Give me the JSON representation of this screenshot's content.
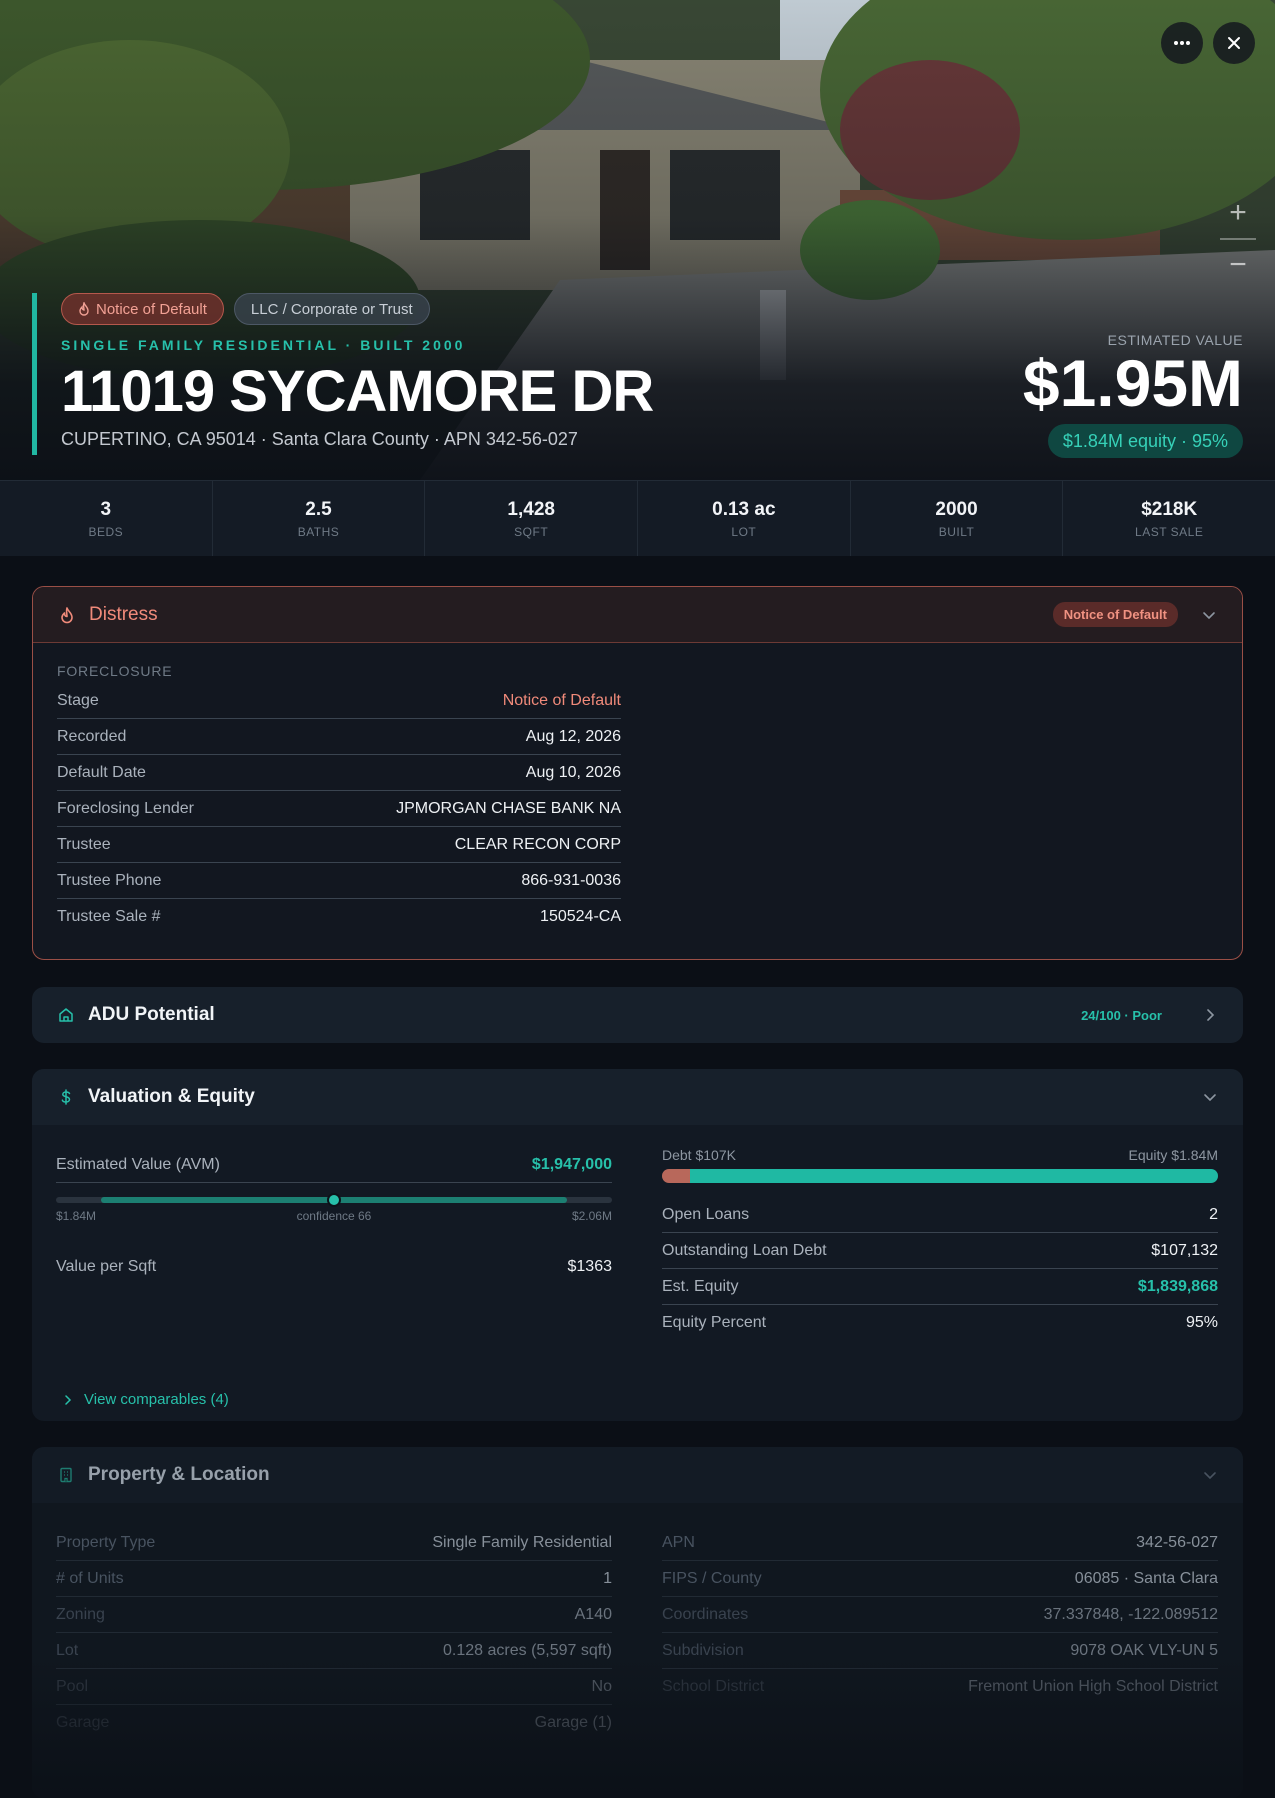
{
  "hero": {
    "chips": {
      "distress": "Notice of Default",
      "owner_type": "LLC / Corporate or Trust"
    },
    "eyebrow": "SINGLE FAMILY RESIDENTIAL · BUILT 2000",
    "address": "11019 SYCAMORE DR",
    "subline": "CUPERTINO, CA 95014 · Santa Clara County · APN 342-56-027",
    "estimated_label": "ESTIMATED VALUE",
    "estimated_value": "$1.95M",
    "equity_pill": "$1.84M equity · 95%"
  },
  "stats": [
    {
      "value": "3",
      "label": "BEDS"
    },
    {
      "value": "2.5",
      "label": "BATHS"
    },
    {
      "value": "1,428",
      "label": "SQFT"
    },
    {
      "value": "0.13 ac",
      "label": "LOT"
    },
    {
      "value": "2000",
      "label": "BUILT"
    },
    {
      "value": "$218K",
      "label": "LAST SALE"
    }
  ],
  "distress": {
    "title": "Distress",
    "badge": "Notice of Default",
    "section": "FORECLOSURE",
    "rows": [
      {
        "k": "Stage",
        "v": "Notice of Default"
      },
      {
        "k": "Recorded",
        "v": "Aug 12, 2026"
      },
      {
        "k": "Default Date",
        "v": "Aug 10, 2026"
      },
      {
        "k": "Foreclosing Lender",
        "v": "JPMORGAN CHASE BANK NA"
      },
      {
        "k": "Trustee",
        "v": "CLEAR RECON CORP"
      },
      {
        "k": "Trustee Phone",
        "v": "866-931-0036"
      },
      {
        "k": "Trustee Sale #",
        "v": "150524-CA"
      }
    ]
  },
  "adu": {
    "title": "ADU Potential",
    "score": "24/100 · Poor"
  },
  "valuation": {
    "title": "Valuation & Equity",
    "avm_label": "Estimated Value (AVM)",
    "avm_value": "$1,947,000",
    "range_low": "$1.84M",
    "confidence": "confidence 66",
    "range_high": "$2.06M",
    "per_sqft_label": "Value per Sqft",
    "per_sqft_value": "$1363",
    "debt_label": "Debt $107K",
    "equity_label": "Equity $1.84M",
    "equity_fraction": 0.95,
    "rows": [
      {
        "k": "Open Loans",
        "v": "2"
      },
      {
        "k": "Outstanding Loan Debt",
        "v": "$107,132"
      },
      {
        "k": "Est. Equity",
        "v": "$1,839,868"
      },
      {
        "k": "Equity Percent",
        "v": "95%"
      }
    ],
    "comparables": "View comparables (4)"
  },
  "property": {
    "title": "Property & Location",
    "left": [
      {
        "k": "Property Type",
        "v": "Single Family Residential"
      },
      {
        "k": "# of Units",
        "v": "1"
      },
      {
        "k": "Zoning",
        "v": "A140"
      },
      {
        "k": "Lot",
        "v": "0.128 acres (5,597 sqft)"
      },
      {
        "k": "Pool",
        "v": "No"
      },
      {
        "k": "Garage",
        "v": "Garage (1)"
      }
    ],
    "right": [
      {
        "k": "APN",
        "v": "342-56-027"
      },
      {
        "k": "FIPS / County",
        "v": "06085 · Santa Clara"
      },
      {
        "k": "Coordinates",
        "v": "37.337848, -122.089512"
      },
      {
        "k": "Subdivision",
        "v": "9078 OAK VLY-UN 5"
      },
      {
        "k": "School District",
        "v": "Fremont Union High School District"
      }
    ]
  },
  "colors": {
    "accent": "#27c0aa",
    "distress": "#f08a7a",
    "debt": "#b8685b",
    "equity": "#1fb9a3"
  }
}
